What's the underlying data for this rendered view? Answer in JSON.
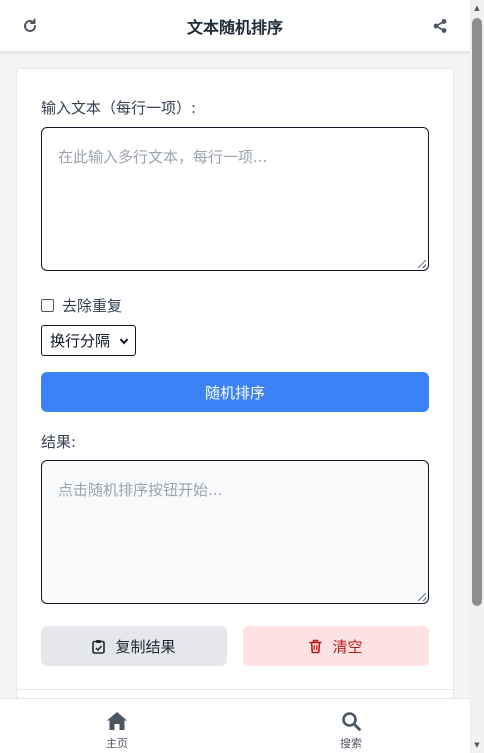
{
  "header": {
    "title": "文本随机排序",
    "refresh_icon": "refresh-icon",
    "share_icon": "share-icon"
  },
  "form": {
    "input_label": "输入文本（每行一项）:",
    "input_placeholder": "在此输入多行文本，每行一项...",
    "dedupe_label": "去除重复",
    "dedupe_checked": false,
    "separator_selected": "换行分隔",
    "shuffle_button": "随机排序",
    "result_label": "结果:",
    "result_placeholder": "点击随机排序按钮开始...",
    "copy_button": "复制结果",
    "clear_button": "清空"
  },
  "nav": {
    "home_label": "主页",
    "search_label": "搜索"
  },
  "colors": {
    "primary": "#3b82f6",
    "danger_bg": "#fee2e2",
    "danger_text": "#b91c1c",
    "neutral_bg": "#e5e7eb"
  }
}
